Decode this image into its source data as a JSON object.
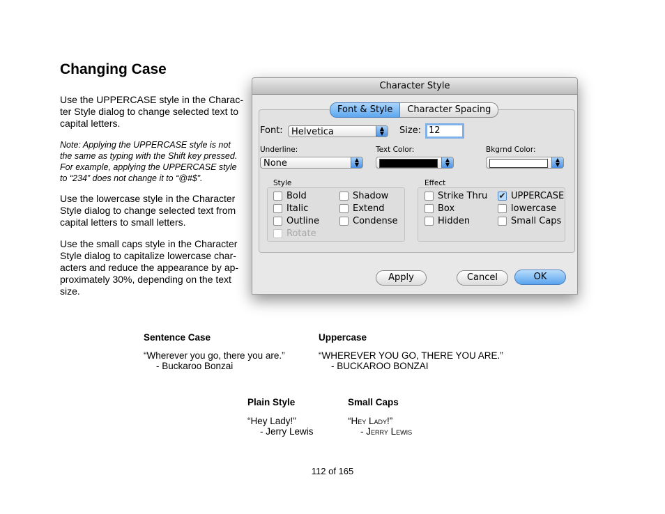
{
  "page": {
    "title": "Changing Case",
    "paragraph1": "Use the UPPERCASE style in the Charac-\nter Style dialog to change selected text to\ncapital letters.",
    "note": "Note: Applying the UPPERCASE style is not\nthe same as typing with the Shift key pressed.\nFor example, applying the UPPERCASE style\nto “234” does not change it to “@#$”.",
    "paragraph2": "Use the lowercase style in the Character\nStyle dialog to change selected text from\ncapital letters to small letters.",
    "paragraph3": "Use the small caps style in the Character\nStyle dialog to capitalize lowercase char-\nacters and reduce the appearance by ap-\nproximately 30%, depending on the text\nsize.",
    "page_number": "112 of 165"
  },
  "dialog": {
    "title": "Character Style",
    "tabs": [
      "Font & Style",
      "Character Spacing"
    ],
    "font_label": "Font:",
    "font_value": "Helvetica",
    "size_label": "Size:",
    "size_value": "12",
    "underline_label": "Underline:",
    "underline_value": "None",
    "text_color_label": "Text Color:",
    "text_color": "#000000",
    "bkgrnd_color_label": "Bkgrnd Color:",
    "bkgrnd_color": "#ffffff",
    "style_label": "Style",
    "style_options": [
      "Bold",
      "Italic",
      "Outline",
      "Rotate",
      "Shadow",
      "Extend",
      "Condense"
    ],
    "effect_label": "Effect",
    "effect_options": [
      "Strike Thru",
      "Box",
      "Hidden",
      "UPPERCASE",
      "lowercase",
      "Small Caps"
    ],
    "checked": "UPPERCASE",
    "buttons": {
      "apply": "Apply",
      "cancel": "Cancel",
      "ok": "OK"
    },
    "accent_color": "#5da7ef"
  },
  "examples": {
    "sentence_case": {
      "heading": "Sentence Case",
      "line1": "“Wherever you go, there you are.”",
      "line2": "- Buckaroo Bonzai"
    },
    "uppercase": {
      "heading": "Uppercase",
      "line1": "“WHEREVER YOU GO, THERE YOU ARE.”",
      "line2": "- BUCKAROO BONZAI"
    },
    "plain_style": {
      "heading": "Plain Style",
      "line1": "“Hey Lady!”",
      "line2": "- Jerry Lewis"
    },
    "small_caps": {
      "heading": "Small Caps",
      "line1": "“Hey Lady!”",
      "line2": "- Jerry Lewis"
    }
  }
}
